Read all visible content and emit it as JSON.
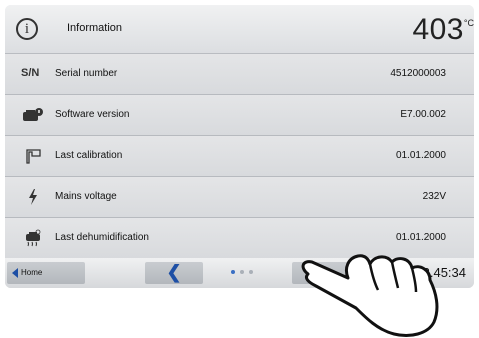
{
  "header": {
    "title": "Information",
    "temperature": "403",
    "temperature_unit": "°C"
  },
  "rows": [
    {
      "icon": "sn-label",
      "label": "Serial number",
      "value": "4512000003"
    },
    {
      "icon": "software-icon",
      "label": "Software version",
      "value": "E7.00.002"
    },
    {
      "icon": "calibration-icon",
      "label": "Last calibration",
      "value": "01.01.2000"
    },
    {
      "icon": "lightning-icon",
      "label": "Mains voltage",
      "value": "232V"
    },
    {
      "icon": "dehumidification-icon",
      "label": "Last dehumidification",
      "value": "01.01.2000"
    }
  ],
  "sn_prefix": "S/N",
  "footer": {
    "home_label": "Home",
    "clock": "13.45:34",
    "page_indicator": {
      "total": 3,
      "current": 1
    }
  },
  "colors": {
    "accent": "#1d4fa5",
    "active_dot": "#3a6fc4"
  }
}
